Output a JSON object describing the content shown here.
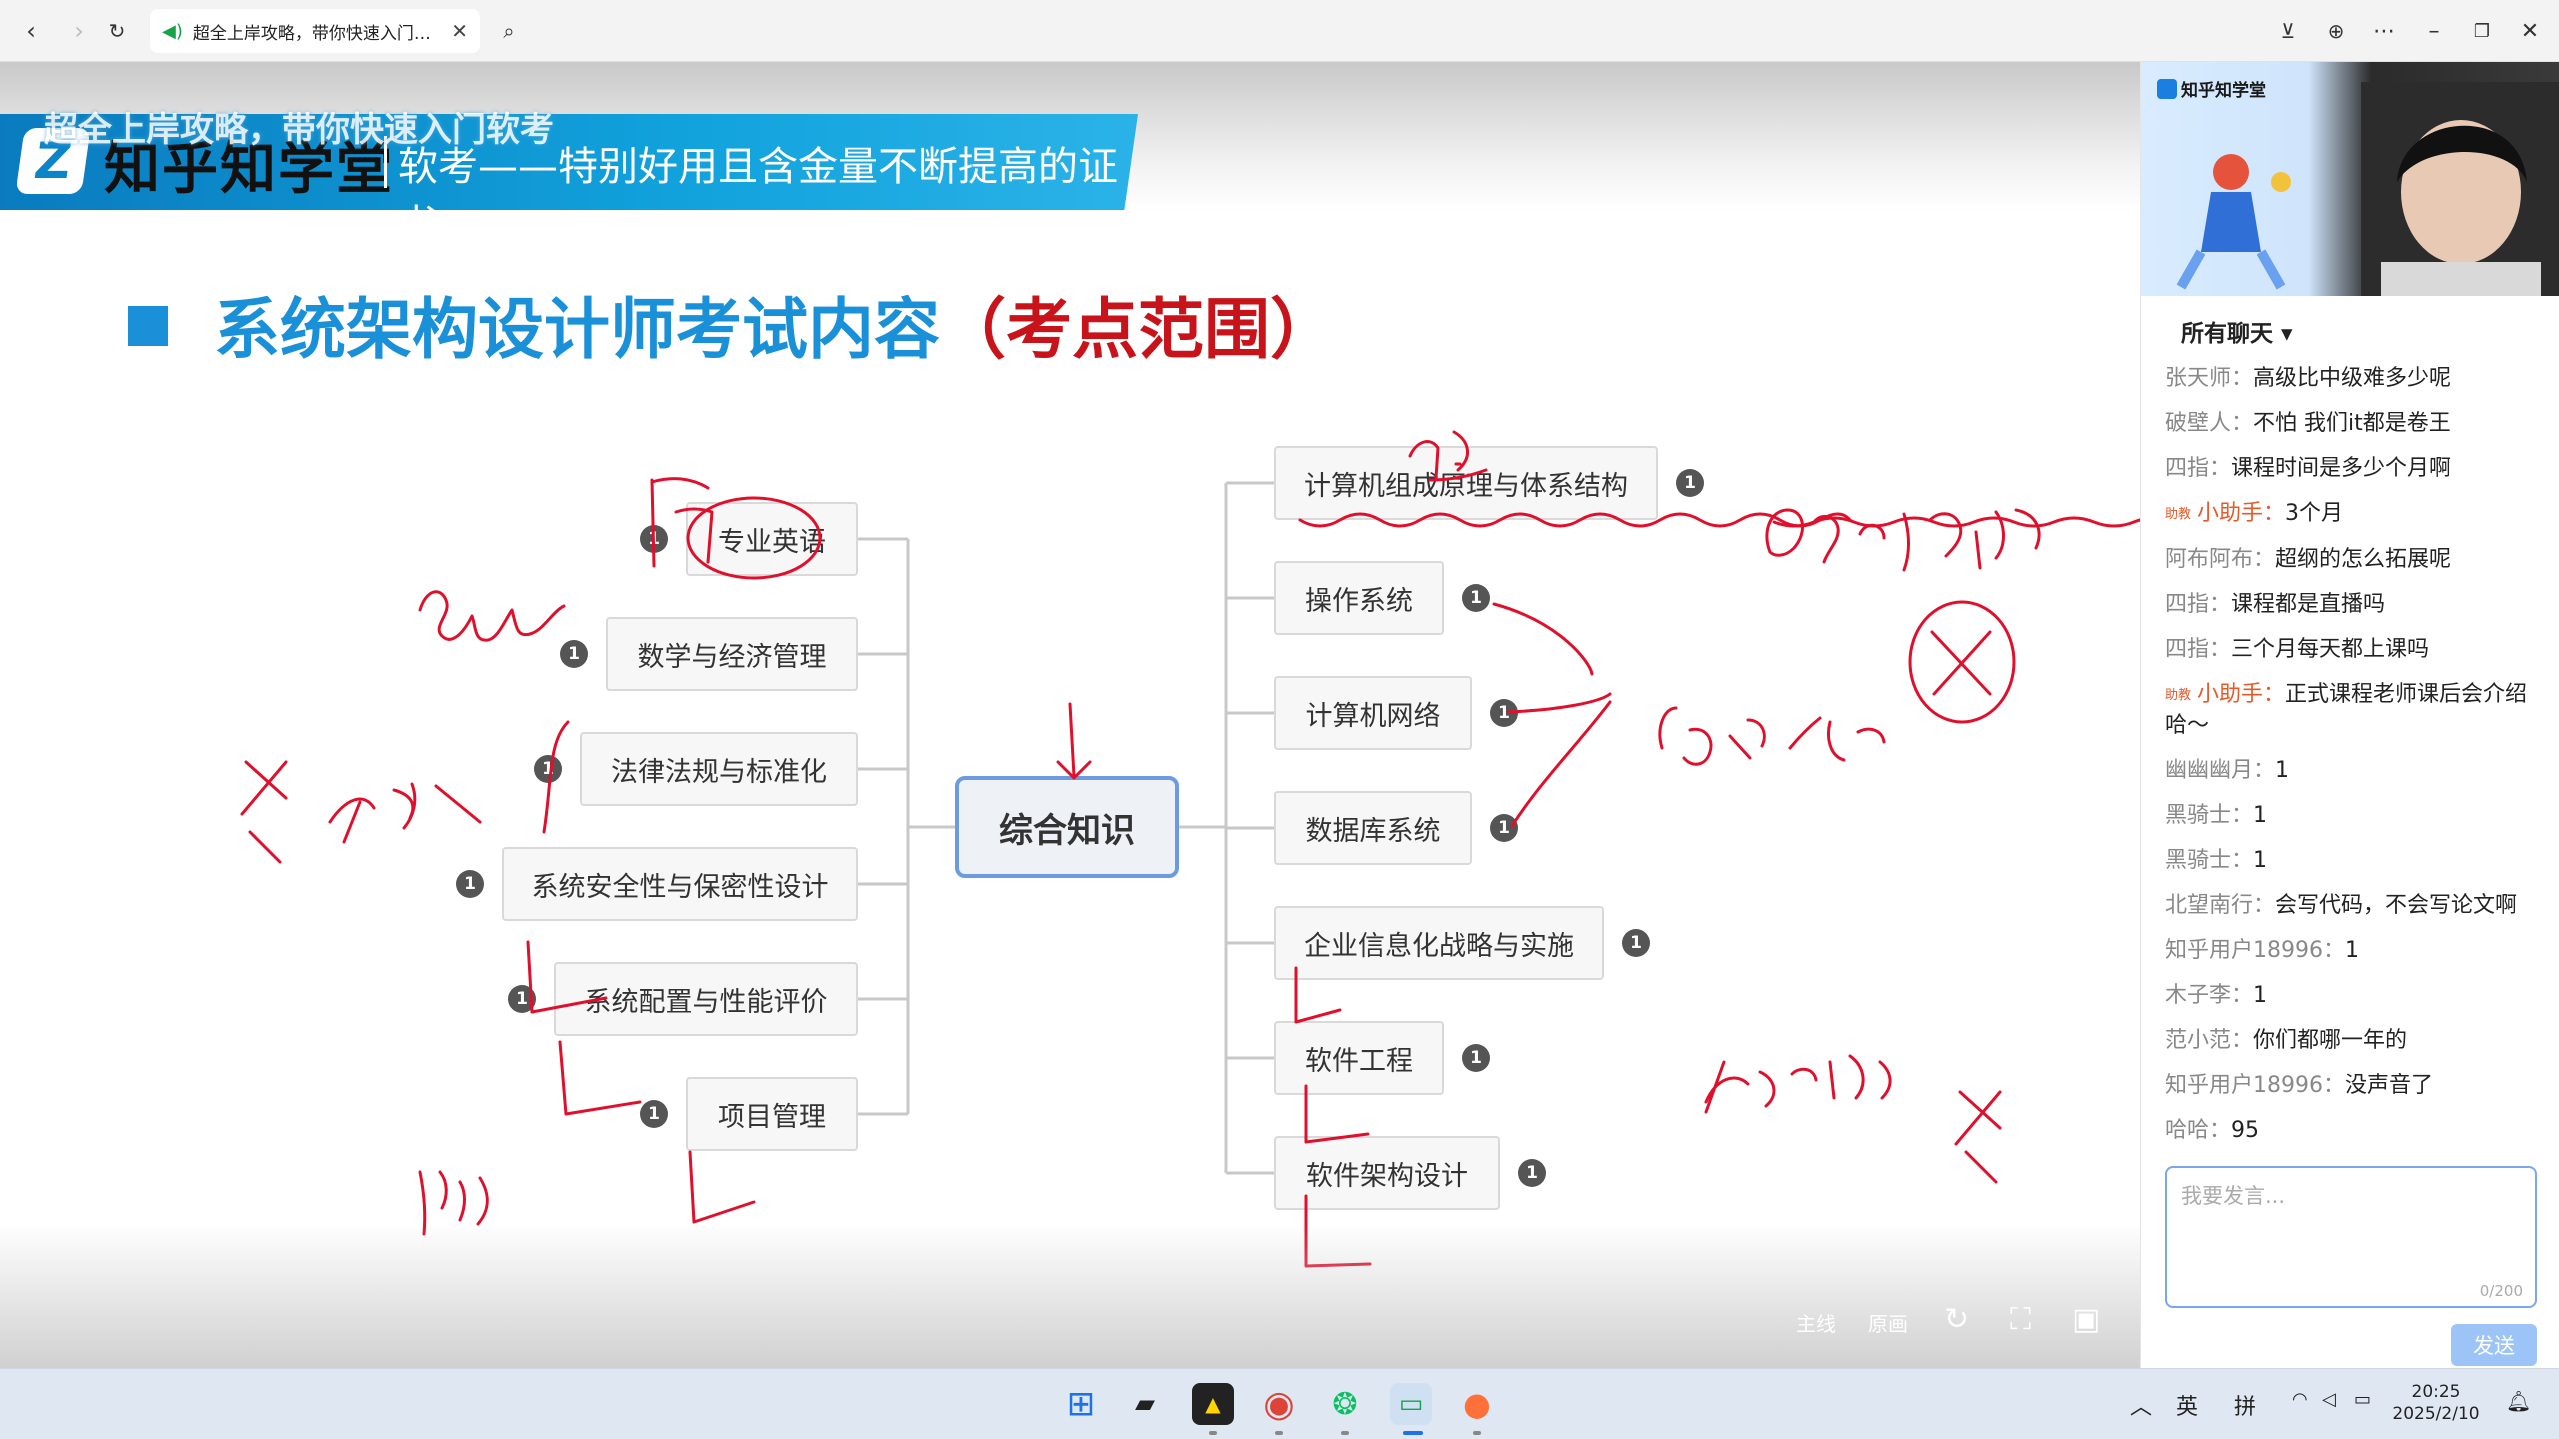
{
  "browser": {
    "tab_title": "超全上岸攻略，带你快速入门…",
    "tab_close": "✕"
  },
  "slide": {
    "overlay_title": "超全上岸攻略，带你快速入门软考",
    "banner_brand": "知乎知学堂",
    "banner_slogan": "软考——特别好用且含金量不断提高的证书",
    "heading_main": "系统架构设计师考试内容",
    "heading_highlight": "（考点范围）",
    "center_node": "综合知识",
    "left_nodes": [
      {
        "label": "专业英语",
        "badge": "1"
      },
      {
        "label": "数学与经济管理",
        "badge": "1"
      },
      {
        "label": "法律法规与标准化",
        "badge": "1"
      },
      {
        "label": "系统安全性与保密性设计",
        "badge": "1"
      },
      {
        "label": "系统配置与性能评价",
        "badge": "1"
      },
      {
        "label": "项目管理",
        "badge": "1"
      }
    ],
    "right_nodes": [
      {
        "label": "计算机组成原理与体系结构",
        "badge": "1"
      },
      {
        "label": "操作系统",
        "badge": "1"
      },
      {
        "label": "计算机网络",
        "badge": "1"
      },
      {
        "label": "数据库系统",
        "badge": "1"
      },
      {
        "label": "企业信息化战略与实施",
        "badge": "1"
      },
      {
        "label": "软件工程",
        "badge": "1"
      },
      {
        "label": "软件架构设计",
        "badge": "1"
      }
    ],
    "player_controls": {
      "line_main": "主线",
      "line_original": "原画"
    }
  },
  "panel": {
    "video_logo": "知乎知学堂",
    "chat_filter": "所有聊天 ▾",
    "messages": [
      {
        "user": "张天师",
        "text": "高级比中级难多少呢",
        "helper": false
      },
      {
        "user": "破壁人",
        "text": "不怕 我们it都是卷王",
        "helper": false
      },
      {
        "user": "四指",
        "text": "课程时间是多少个月啊",
        "helper": false
      },
      {
        "user": "小助手",
        "text": "3个月",
        "helper": true,
        "tag": "助教"
      },
      {
        "user": "阿布阿布",
        "text": "超纲的怎么拓展呢",
        "helper": false
      },
      {
        "user": "四指",
        "text": "课程都是直播吗",
        "helper": false
      },
      {
        "user": "四指",
        "text": "三个月每天都上课吗",
        "helper": false
      },
      {
        "user": "小助手",
        "text": "正式课程老师课后会介绍哈～",
        "helper": true,
        "tag": "助教"
      },
      {
        "user": "幽幽幽月",
        "text": "1",
        "helper": false
      },
      {
        "user": "黑骑士",
        "text": "1",
        "helper": false
      },
      {
        "user": "黑骑士",
        "text": "1",
        "helper": false
      },
      {
        "user": "北望南行",
        "text": "会写代码，不会写论文啊",
        "helper": false
      },
      {
        "user": "知乎用户18996",
        "text": "1",
        "helper": false
      },
      {
        "user": "木子李",
        "text": "1",
        "helper": false
      },
      {
        "user": "范小范",
        "text": "你们都哪一年的",
        "helper": false
      },
      {
        "user": "知乎用户18996",
        "text": "没声音了",
        "helper": false
      },
      {
        "user": "哈哈",
        "text": "95",
        "helper": false
      }
    ],
    "input_placeholder": "我要发言...",
    "input_count": "0/200",
    "send_label": "发送"
  },
  "taskbar": {
    "ime_lang": "英",
    "ime_mode": "拼",
    "time": "20:25",
    "date": "2025/2/10"
  },
  "colors": {
    "brand_blue": "#1a90d8",
    "highlight_red": "#c8131b",
    "ink_red": "#e0102c",
    "center_border": "#6d9be0"
  }
}
